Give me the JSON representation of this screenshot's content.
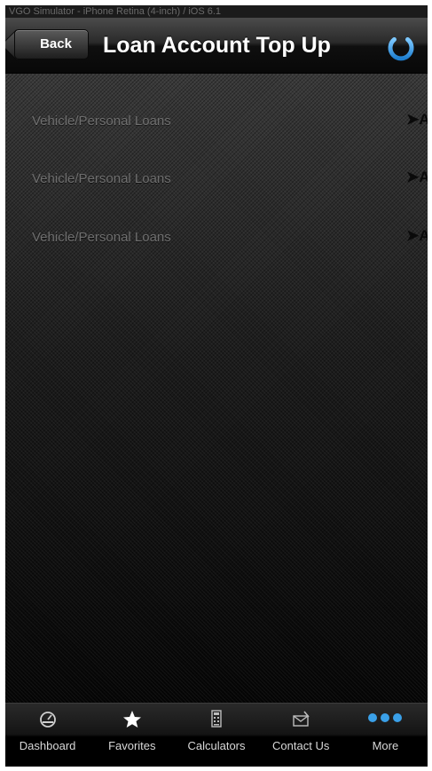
{
  "status_bar": {
    "text": "VGO Simulator - iPhone Retina (4-inch) / iOS 6.1"
  },
  "header": {
    "back_label": "Back",
    "title": "Loan Account Top Up"
  },
  "loans": [
    {
      "label": "Vehicle/Personal Loans",
      "action": "➤Ac"
    },
    {
      "label": "Vehicle/Personal Loans",
      "action": "➤Ac"
    },
    {
      "label": "Vehicle/Personal Loans",
      "action": "➤Ac"
    }
  ],
  "tabs": [
    {
      "label": "Dashboard",
      "icon": "gauge-icon"
    },
    {
      "label": "Favorites",
      "icon": "star-icon"
    },
    {
      "label": "Calculators",
      "icon": "calculator-icon"
    },
    {
      "label": "Contact Us",
      "icon": "envelope-icon"
    },
    {
      "label": "More",
      "icon": "more-dots-icon"
    }
  ],
  "colors": {
    "accent_blue": "#3aa0e8",
    "row_text": "#6e6e6e",
    "tab_text": "#d8d8d8"
  }
}
